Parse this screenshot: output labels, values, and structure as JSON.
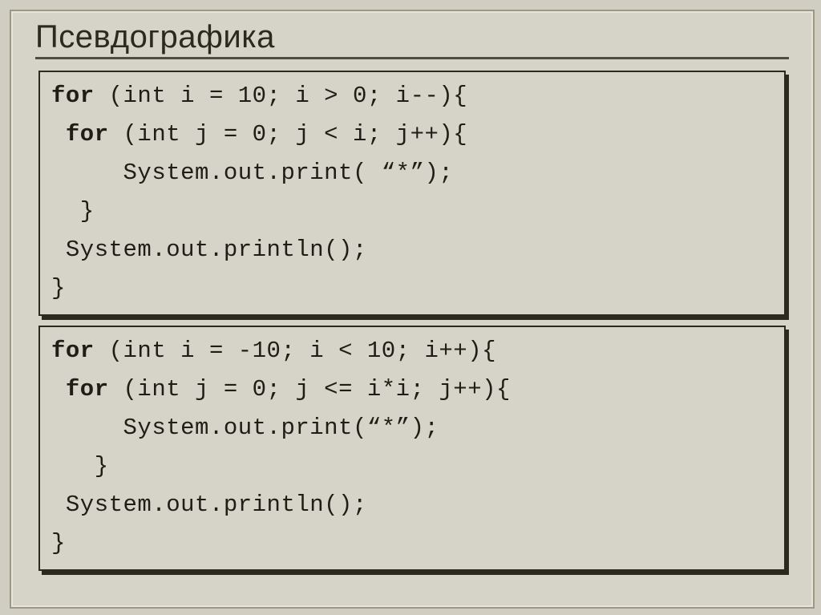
{
  "title": "Псевдографика",
  "code1": {
    "l1a": "for",
    "l1b": " (int i = 10; i > 0; i--){",
    "l2a": " for",
    "l2b": " (int j = 0; j < i; j++){",
    "l3": "     System.out.print( “*”);",
    "l4": "  }",
    "l5": " System.out.println();",
    "l6": "}"
  },
  "code2": {
    "l1a": "for",
    "l1b": " (int i = -10; i < 10; i++){",
    "l2a": " for",
    "l2b": " (int j = 0; j <= i*i; j++){",
    "l3": "     System.out.print(“*”);",
    "l4": "   }",
    "l5": " System.out.println();",
    "l6": "}"
  }
}
